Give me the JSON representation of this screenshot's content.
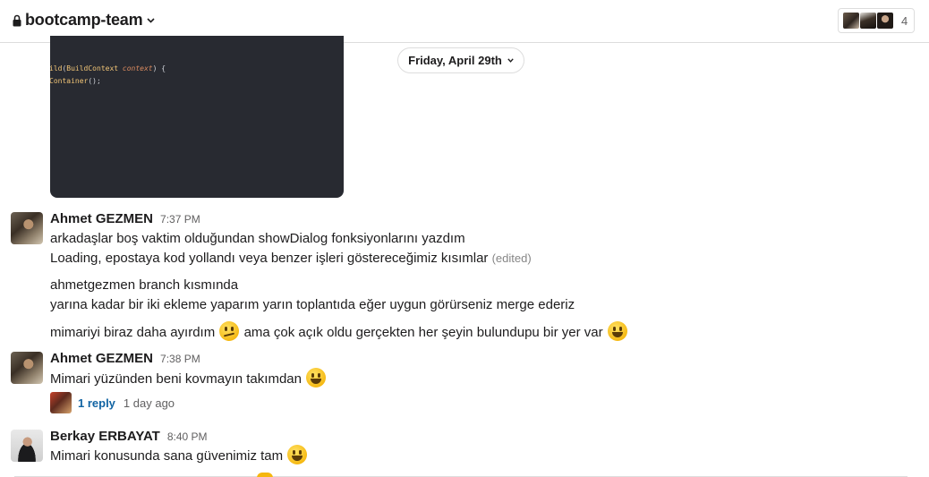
{
  "header": {
    "channel_name": "bootcamp-team",
    "member_count": "4",
    "icons": [
      "lock-icon",
      "chevron-down-icon"
    ]
  },
  "code_preview": {
    "lines": [
      {
        "fn": "ild",
        "open": "(",
        "type": "BuildContext",
        "param": "context",
        "close": ") {"
      },
      {
        "type": "Container",
        "rest": "();"
      }
    ]
  },
  "date_divider": {
    "label": "Friday, April 29th"
  },
  "messages": [
    {
      "author": "Ahmet GEZMEN",
      "time": "7:37 PM",
      "lines": [
        "arkadaşlar boş vaktim olduğundan showDialog fonksiyonlarını yazdım",
        "Loading, epostaya kod yollandı veya benzer işleri göstereceğimiz kısımlar",
        "ahmetgezmen branch kısmında",
        "yarına kadar bir iki ekleme yaparım yarın toplantıda eğer uygun görürseniz merge ederiz"
      ],
      "edited_label": "(edited)",
      "mixed_line": {
        "part1": "mimariyi biraz daha ayırdım",
        "part2": "ama çok açık oldu gerçekten her şeyin bulundupu bir yer var"
      }
    },
    {
      "author": "Ahmet GEZMEN",
      "time": "7:38 PM",
      "text": "Mimari yüzünden beni kovmayın takımdan",
      "thread": {
        "reply_label": "1 reply",
        "age": "1 day ago"
      }
    },
    {
      "author": "Berkay ERBAYAT",
      "time": "8:40 PM",
      "text": "Mimari konusunda sana güvenimiz tam"
    }
  ]
}
